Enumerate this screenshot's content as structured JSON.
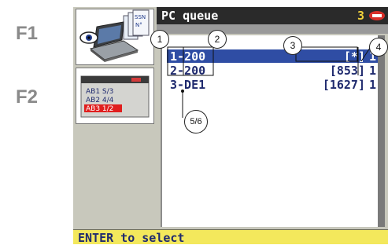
{
  "side_labels": {
    "f1": "F1",
    "f2": "F2"
  },
  "icons": {
    "panel1": "laptop-with-cards-icon",
    "panel2": "ab-list-icon",
    "panel1_cards": [
      "SSN",
      "N°"
    ],
    "panel2_lines": [
      "AB1 S/3",
      "AB2 4/4",
      "AB3 1/2"
    ]
  },
  "header": {
    "title": "PC queue",
    "count": "3",
    "logo": "key-brand-logo-icon"
  },
  "queue": {
    "rows": [
      {
        "name": "1-200",
        "job": "[*]",
        "copies": "1",
        "selected": true
      },
      {
        "name": "2-200",
        "job": "[853]",
        "copies": "1",
        "selected": false
      },
      {
        "name": "3-DE1",
        "job": "[1627]",
        "copies": "1",
        "selected": false
      }
    ]
  },
  "status": {
    "text": "ENTER to select"
  },
  "callouts": [
    "1",
    "2",
    "3",
    "4",
    "5/6"
  ],
  "colors": {
    "titlebar": "#2a2a2a",
    "count": "#f1d23c",
    "selection": "#2f4da4",
    "statusbar": "#f3e85c",
    "text": "#1f2a6e"
  }
}
